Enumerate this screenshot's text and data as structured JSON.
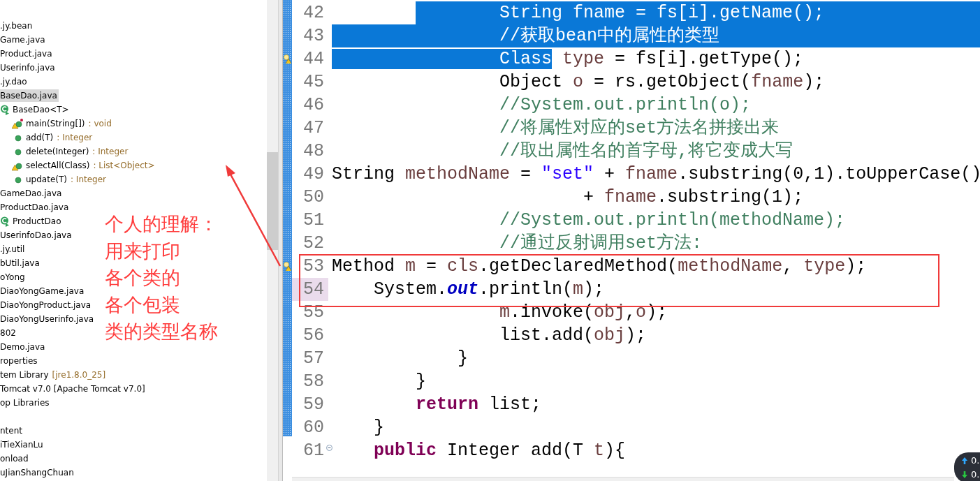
{
  "tree": [
    {
      "label": ".jy.bean",
      "kind": "file",
      "selected": false
    },
    {
      "label": "Game.java",
      "kind": "file",
      "selected": false
    },
    {
      "label": "Product.java",
      "kind": "file",
      "selected": false
    },
    {
      "label": "Userinfo.java",
      "kind": "file",
      "selected": false
    },
    {
      "label": ".jy.dao",
      "kind": "file",
      "selected": false
    },
    {
      "label": "BaseDao.java",
      "kind": "file",
      "selected": true,
      "children": [
        {
          "label": "BaseDao<T>",
          "kind": "class",
          "selected": false,
          "children": [
            {
              "label": "main(String[])",
              "detail": ": void",
              "kind": "method",
              "static": true,
              "warning": true,
              "selected": false
            },
            {
              "label": "add(T)",
              "detail": ": Integer",
              "kind": "method",
              "static": false,
              "warning": false,
              "selected": false
            },
            {
              "label": "delete(Integer)",
              "detail": ": Integer",
              "kind": "method",
              "static": false,
              "warning": false,
              "selected": false
            },
            {
              "label": "selectAll(Class)",
              "detail": ": List<Object>",
              "kind": "method",
              "static": false,
              "warning": true,
              "selected": false
            },
            {
              "label": "update(T)",
              "detail": ": Integer",
              "kind": "method",
              "static": false,
              "warning": false,
              "selected": false
            }
          ]
        }
      ]
    },
    {
      "label": "GameDao.java",
      "kind": "file",
      "selected": false
    },
    {
      "label": "ProductDao.java",
      "kind": "file",
      "selected": false,
      "children": [
        {
          "label": "ProductDao",
          "kind": "class",
          "selected": false
        }
      ]
    },
    {
      "label": "UserinfoDao.java",
      "kind": "file",
      "selected": false
    },
    {
      "label": ".jy.util",
      "kind": "file",
      "selected": false
    },
    {
      "label": "bUtil.java",
      "kind": "file",
      "selected": false
    },
    {
      "label": "oYong",
      "kind": "file",
      "selected": false
    },
    {
      "label": "DiaoYongGame.java",
      "kind": "file",
      "selected": false
    },
    {
      "label": "DiaoYongProduct.java",
      "kind": "file",
      "selected": false
    },
    {
      "label": "DiaoYongUserinfo.java",
      "kind": "file",
      "selected": false
    },
    {
      "label": "802",
      "kind": "file",
      "selected": false
    },
    {
      "label": "Demo.java",
      "kind": "file",
      "selected": false
    },
    {
      "label": "roperties",
      "kind": "file",
      "selected": false
    },
    {
      "label": "tem Library",
      "detail": "[jre1.8.0_25]",
      "kind": "file",
      "selected": false
    },
    {
      "label": "Tomcat v7.0 [Apache Tomcat v7.0]",
      "kind": "file",
      "selected": false
    },
    {
      "label": "op Libraries",
      "kind": "file",
      "selected": false
    },
    {
      "kind": "spacer"
    },
    {
      "label": "ntent",
      "kind": "file",
      "selected": false
    },
    {
      "label": "iTieXianLu",
      "kind": "file",
      "selected": false
    },
    {
      "label": "onload",
      "kind": "file",
      "selected": false
    },
    {
      "label": "uJianShangChuan",
      "kind": "file",
      "selected": false
    }
  ],
  "editor": {
    "lines": [
      {
        "number": "42",
        "selected": true,
        "selection_cut": true,
        "current": false,
        "warning": false,
        "fold": false,
        "tokens": [
          {
            "text": "                String fname = fs[i].getName();",
            "kind": "plain"
          }
        ]
      },
      {
        "number": "43",
        "selected": true,
        "selection_cut": false,
        "current": false,
        "warning": false,
        "fold": false,
        "tokens": [
          {
            "text": "                //获取bean中的属性的类型",
            "kind": "comment"
          }
        ]
      },
      {
        "number": "44",
        "selected": false,
        "selection_cut": true,
        "current": false,
        "warning": true,
        "fold": false,
        "tokens": [
          {
            "text": "                Class",
            "kind": "plain"
          },
          {
            "text": " type",
            "kind": "var"
          },
          {
            "text": " = fs[i].getType();",
            "kind": "plain"
          }
        ]
      },
      {
        "number": "45",
        "selected": false,
        "selection_cut": false,
        "current": false,
        "warning": false,
        "fold": false,
        "tokens": [
          {
            "text": "                Object ",
            "kind": "plain"
          },
          {
            "text": "o",
            "kind": "var"
          },
          {
            "text": " = rs.getObject(",
            "kind": "plain"
          },
          {
            "text": "fname",
            "kind": "var"
          },
          {
            "text": ");",
            "kind": "plain"
          }
        ]
      },
      {
        "number": "46",
        "selected": false,
        "selection_cut": false,
        "current": false,
        "warning": false,
        "fold": false,
        "tokens": [
          {
            "text": "                //System.out.println(o);",
            "kind": "comment"
          }
        ]
      },
      {
        "number": "47",
        "selected": false,
        "selection_cut": false,
        "current": false,
        "warning": false,
        "fold": false,
        "tokens": [
          {
            "text": "                //将属性对应的set方法名拼接出来",
            "kind": "comment"
          }
        ]
      },
      {
        "number": "48",
        "selected": false,
        "selection_cut": false,
        "current": false,
        "warning": false,
        "fold": false,
        "tokens": [
          {
            "text": "                //取出属性名的首字母,将它变成大写",
            "kind": "comment"
          }
        ]
      },
      {
        "number": "49",
        "selected": false,
        "selection_cut": false,
        "current": false,
        "warning": false,
        "fold": false,
        "tokens": [
          {
            "text": "String ",
            "kind": "plain"
          },
          {
            "text": "methodName",
            "kind": "var"
          },
          {
            "text": " = ",
            "kind": "plain"
          },
          {
            "text": "\"set\"",
            "kind": "string"
          },
          {
            "text": " + ",
            "kind": "plain"
          },
          {
            "text": "fname",
            "kind": "var"
          },
          {
            "text": ".substring(0,1).toUpperCase()",
            "kind": "plain"
          }
        ]
      },
      {
        "number": "50",
        "selected": false,
        "selection_cut": false,
        "current": false,
        "warning": false,
        "fold": false,
        "tokens": [
          {
            "text": "                        + ",
            "kind": "plain"
          },
          {
            "text": "fname",
            "kind": "var"
          },
          {
            "text": ".substring(1);",
            "kind": "plain"
          }
        ]
      },
      {
        "number": "51",
        "selected": false,
        "selection_cut": false,
        "current": false,
        "warning": false,
        "fold": false,
        "tokens": [
          {
            "text": "                //System.out.println(methodName);",
            "kind": "comment"
          }
        ]
      },
      {
        "number": "52",
        "selected": false,
        "selection_cut": false,
        "current": false,
        "warning": false,
        "fold": false,
        "tokens": [
          {
            "text": "                //通过反射调用set方法:",
            "kind": "comment"
          }
        ]
      },
      {
        "number": "53",
        "selected": false,
        "selection_cut": false,
        "current": false,
        "warning": true,
        "fold": false,
        "tokens": [
          {
            "text": "Method ",
            "kind": "plain"
          },
          {
            "text": "m",
            "kind": "var"
          },
          {
            "text": " = ",
            "kind": "plain"
          },
          {
            "text": "cls",
            "kind": "var"
          },
          {
            "text": ".getDeclaredMethod(",
            "kind": "plain"
          },
          {
            "text": "methodName",
            "kind": "var"
          },
          {
            "text": ", ",
            "kind": "plain"
          },
          {
            "text": "type",
            "kind": "var"
          },
          {
            "text": ");",
            "kind": "plain"
          }
        ]
      },
      {
        "number": "54",
        "selected": false,
        "selection_cut": false,
        "current": true,
        "warning": false,
        "fold": false,
        "tokens": [
          {
            "text": "    System.",
            "kind": "plain"
          },
          {
            "text": "out",
            "kind": "field"
          },
          {
            "text": ".println(",
            "kind": "plain"
          },
          {
            "text": "m",
            "kind": "var"
          },
          {
            "text": ");",
            "kind": "plain"
          }
        ]
      },
      {
        "number": "55",
        "selected": false,
        "selection_cut": false,
        "current": false,
        "warning": false,
        "fold": false,
        "tokens": [
          {
            "text": "                m",
            "kind": "var"
          },
          {
            "text": ".invoke(",
            "kind": "plain"
          },
          {
            "text": "obj",
            "kind": "var"
          },
          {
            "text": ",",
            "kind": "plain"
          },
          {
            "text": "o",
            "kind": "var"
          },
          {
            "text": ");",
            "kind": "plain"
          }
        ]
      },
      {
        "number": "56",
        "selected": false,
        "selection_cut": false,
        "current": false,
        "warning": false,
        "fold": false,
        "tokens": [
          {
            "text": "                list.add(",
            "kind": "plain"
          },
          {
            "text": "obj",
            "kind": "var"
          },
          {
            "text": ");",
            "kind": "plain"
          }
        ]
      },
      {
        "number": "57",
        "selected": false,
        "selection_cut": false,
        "current": false,
        "warning": false,
        "fold": false,
        "tokens": [
          {
            "text": "            }",
            "kind": "plain"
          }
        ]
      },
      {
        "number": "58",
        "selected": false,
        "selection_cut": false,
        "current": false,
        "warning": false,
        "fold": false,
        "tokens": [
          {
            "text": "        }",
            "kind": "plain"
          }
        ]
      },
      {
        "number": "59",
        "selected": false,
        "selection_cut": false,
        "current": false,
        "warning": false,
        "fold": false,
        "tokens": [
          {
            "text": "        return",
            "kind": "keyword"
          },
          {
            "text": " list;",
            "kind": "plain"
          }
        ]
      },
      {
        "number": "60",
        "selected": false,
        "selection_cut": false,
        "current": false,
        "warning": false,
        "fold": false,
        "tokens": [
          {
            "text": "    }",
            "kind": "plain"
          }
        ]
      },
      {
        "number": "61",
        "selected": false,
        "selection_cut": false,
        "current": false,
        "warning": false,
        "fold": true,
        "tokens": [
          {
            "text": "    public",
            "kind": "keyword"
          },
          {
            "text": " Integer add(T ",
            "kind": "plain"
          },
          {
            "text": "t",
            "kind": "var"
          },
          {
            "text": "){",
            "kind": "plain"
          }
        ]
      }
    ]
  },
  "annotation": {
    "lines": [
      "个人的理解：",
      "用来打印",
      "各个类的",
      "各个包装",
      "类的类型名称"
    ]
  },
  "network": {
    "upload": "0.",
    "download": "0."
  }
}
